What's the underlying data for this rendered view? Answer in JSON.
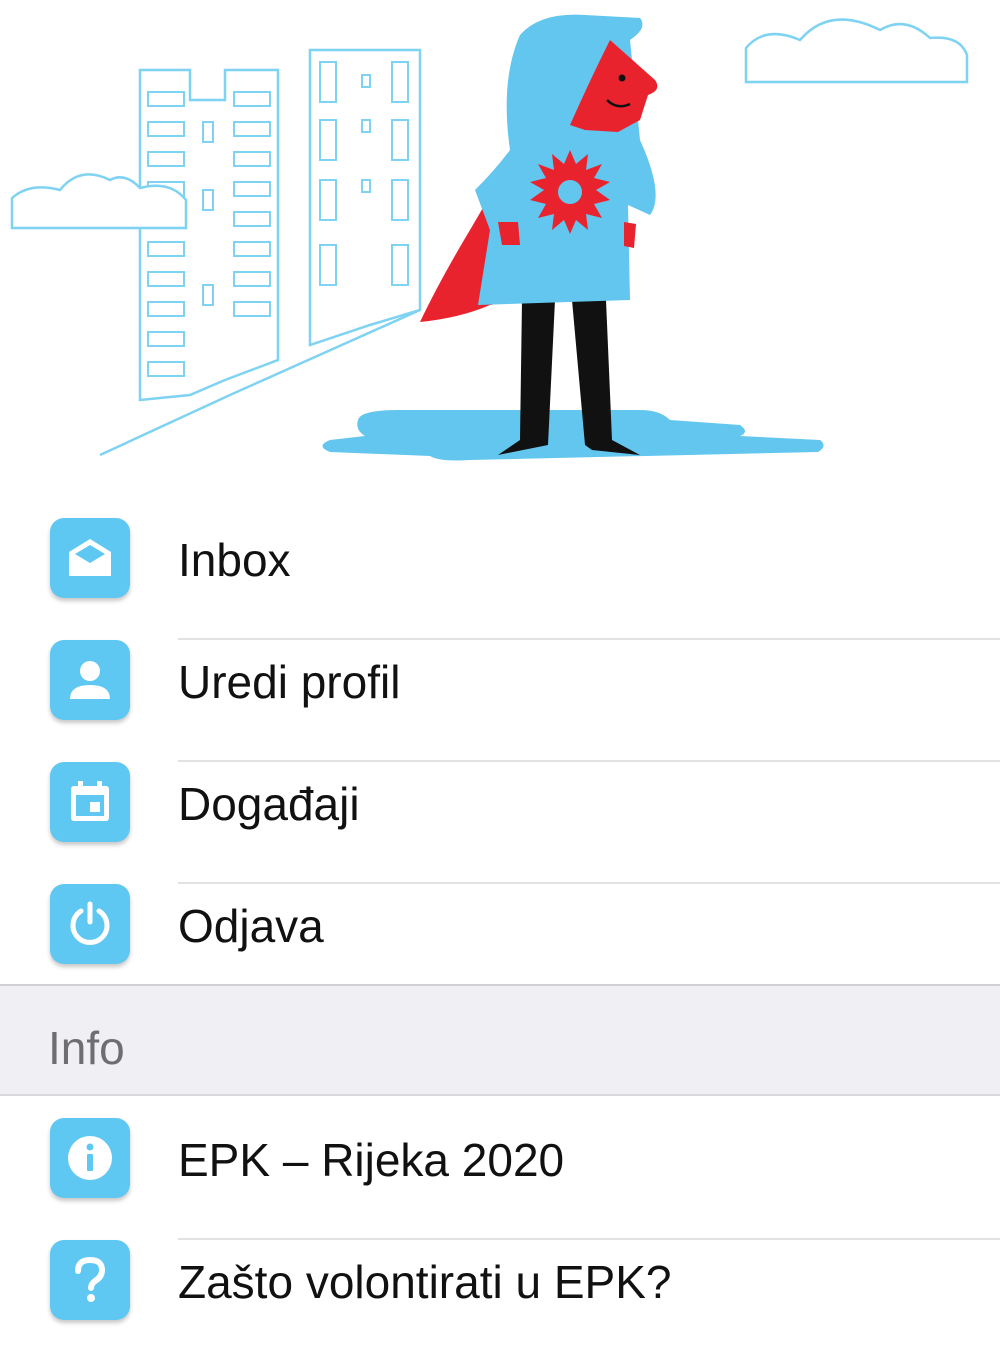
{
  "menu": {
    "items": [
      {
        "label": "Inbox",
        "icon": "mail-open-icon"
      },
      {
        "label": "Uredi profil",
        "icon": "person-icon"
      },
      {
        "label": "Događaji",
        "icon": "calendar-icon"
      },
      {
        "label": "Odjava",
        "icon": "power-icon"
      }
    ]
  },
  "info_section": {
    "title": "Info",
    "items": [
      {
        "label": "EPK – Rijeka 2020",
        "icon": "info-icon"
      },
      {
        "label": "Zašto volontirati u EPK?",
        "icon": "question-icon"
      }
    ]
  },
  "colors": {
    "accent": "#5ec8f2",
    "hero_red": "#e8232e",
    "hero_outline": "#7fd3f2",
    "section_bg": "#efeff4"
  }
}
